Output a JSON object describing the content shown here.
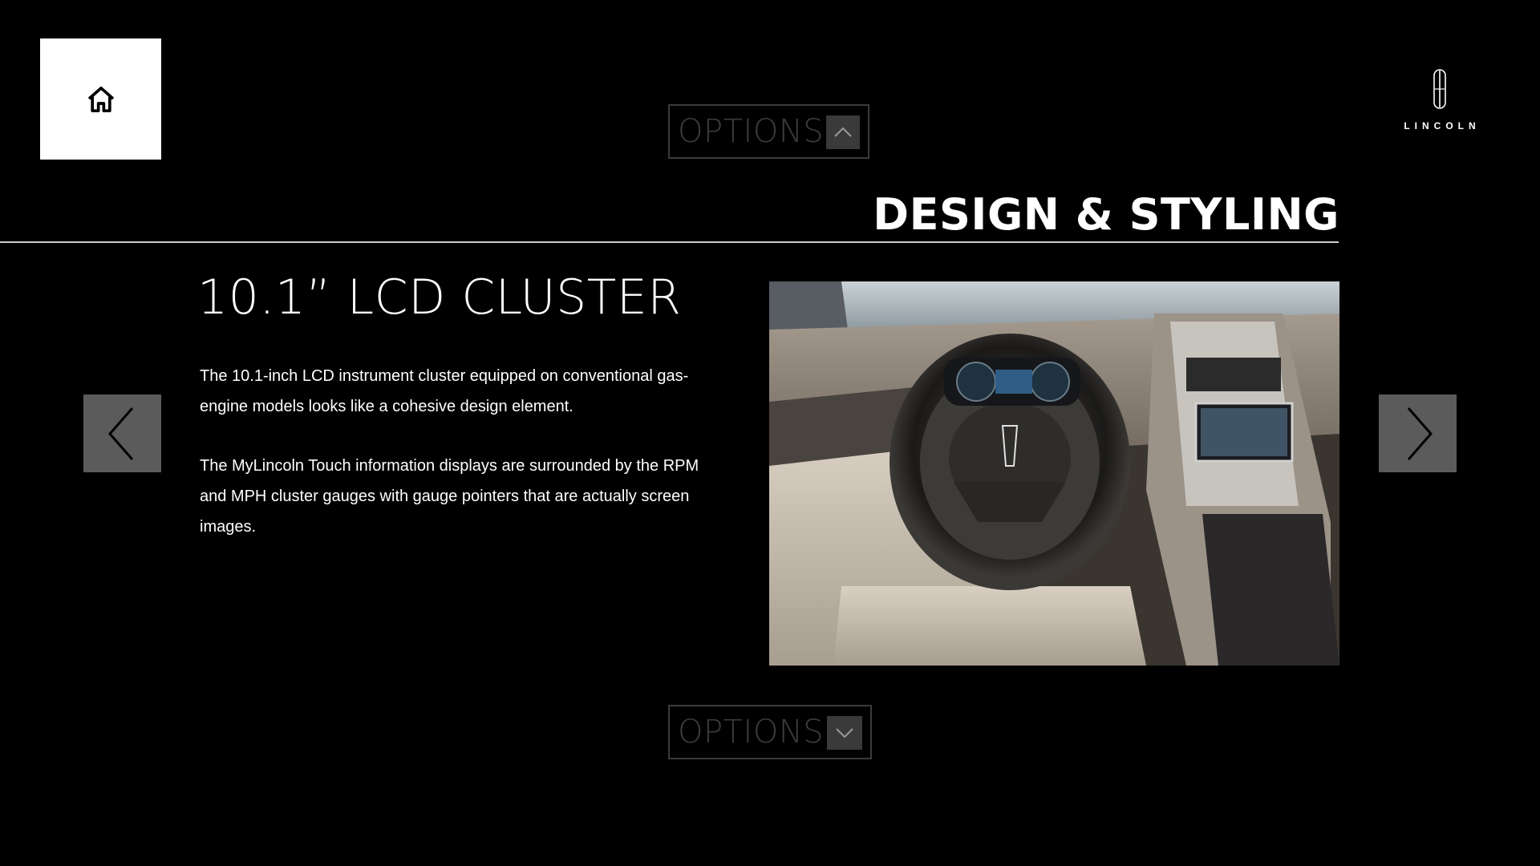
{
  "header": {
    "home_icon": "home-icon",
    "options_label_top": "OPTIONS",
    "options_label_bottom": "OPTIONS",
    "brand": "LINCOLN"
  },
  "section": {
    "title": "DESIGN & STYLING"
  },
  "feature": {
    "title": "10.1” LCD CLUSTER",
    "paragraphs": [
      "The 10.1-inch LCD instrument cluster equipped on conventional gas-engine models looks like a cohesive design element.",
      "The MyLincoln Touch information displays are surrounded by the RPM and MPH cluster gauges with gauge pointers that are actually screen images."
    ]
  },
  "navigation": {
    "prev_icon": "chevron-left-icon",
    "next_icon": "chevron-right-icon"
  },
  "colors": {
    "background": "#000000",
    "nav_button": "#5b5b5b",
    "options_border": "#3a3a3a"
  }
}
